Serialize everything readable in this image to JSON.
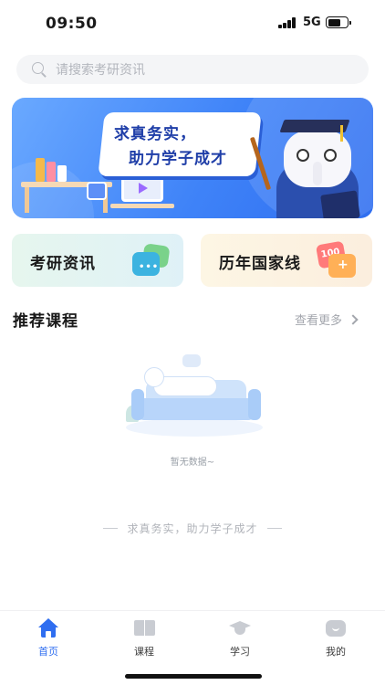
{
  "status_bar": {
    "time": "09:50",
    "network": "5G"
  },
  "search": {
    "placeholder": "请搜索考研资讯"
  },
  "banner": {
    "slogan_line1": "求真务实，",
    "slogan_line2": "助力学子成才"
  },
  "quick_links": [
    {
      "label": "考研资讯",
      "icon": "chat-bubbles-icon"
    },
    {
      "label": "历年国家线",
      "icon": "score-card-icon",
      "icon_text": "100"
    }
  ],
  "recommended": {
    "title": "推荐课程",
    "more_label": "查看更多",
    "empty_text": "暂无数据~"
  },
  "footer": {
    "slogan": "求真务实，助力学子成才"
  },
  "tabs": [
    {
      "label": "首页",
      "icon": "home-icon",
      "active": true
    },
    {
      "label": "课程",
      "icon": "book-icon",
      "active": false
    },
    {
      "label": "学习",
      "icon": "graduation-cap-icon",
      "active": false
    },
    {
      "label": "我的",
      "icon": "profile-icon",
      "active": false
    }
  ],
  "colors": {
    "primary": "#2f6ef0",
    "inactive_tab": "#c9ccd2",
    "muted_text": "#a3a6ad"
  }
}
